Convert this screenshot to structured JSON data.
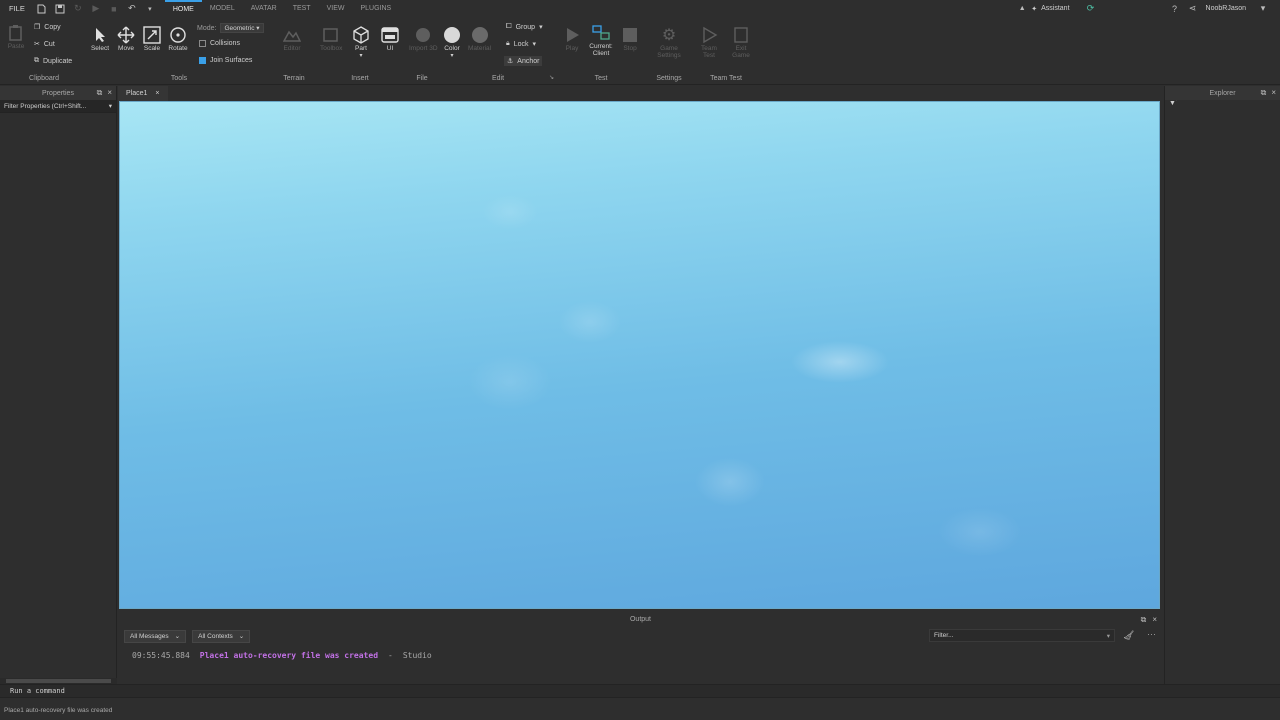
{
  "topbar": {
    "file_label": "FILE",
    "tabs": [
      "HOME",
      "MODEL",
      "AVATAR",
      "TEST",
      "VIEW",
      "PLUGINS"
    ],
    "active_tab": "HOME",
    "assistant_label": "Assistant",
    "user_name": "NoobRJason"
  },
  "ribbon": {
    "clipboard": {
      "paste": "Paste",
      "copy": "Copy",
      "cut": "Cut",
      "duplicate": "Duplicate",
      "label": "Clipboard"
    },
    "tools": {
      "select": "Select",
      "move": "Move",
      "scale": "Scale",
      "rotate": "Rotate",
      "mode_label": "Mode:",
      "mode_value": "Geometric",
      "collisions": "Collisions",
      "join_surfaces": "Join Surfaces",
      "label": "Tools"
    },
    "terrain": {
      "editor": "Editor",
      "label": "Terrain"
    },
    "insert": {
      "toolbox": "Toolbox",
      "part": "Part",
      "ui": "UI",
      "label": "Insert"
    },
    "file": {
      "import": "Import 3D",
      "label": "File"
    },
    "edit": {
      "color": "Color",
      "material": "Material",
      "group": "Group",
      "lock": "Lock",
      "anchor": "Anchor",
      "label": "Edit"
    },
    "test": {
      "play": "Play",
      "current_client": "Current: Client",
      "stop": "Stop",
      "label": "Test"
    },
    "settings": {
      "game_settings": "Game Settings",
      "label": "Settings"
    },
    "team_test": {
      "team_test": "Team Test",
      "exit_game": "Exit Game",
      "label": "Team Test"
    }
  },
  "left_panel": {
    "title": "Properties",
    "filter": "Filter Properties (Ctrl+Shift..."
  },
  "right_panel": {
    "title": "Explorer"
  },
  "doc_tab": {
    "label": "Place1"
  },
  "output": {
    "title": "Output",
    "messages_filter": "All Messages",
    "contexts_filter": "All Contexts",
    "filter_placeholder": "Filter...",
    "log": {
      "time": "09:55:45.884",
      "message": "Place1 auto-recovery file was created",
      "separator": "-",
      "source": "Studio"
    }
  },
  "command_bar": {
    "placeholder": "Run a command"
  },
  "status_bar": {
    "text": "Place1 auto-recovery file was created"
  },
  "colors": {
    "accent": "#3aa0e8",
    "log_message": "#c271e6",
    "sky_top": "#a8e6f4",
    "sky_bottom": "#5ea7de"
  }
}
